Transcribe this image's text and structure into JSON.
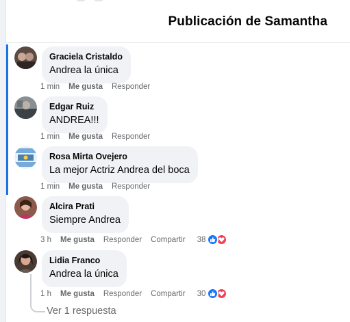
{
  "header": {
    "title": "Publicación de Samantha"
  },
  "colors": {
    "accent": "#1b74e4",
    "like": "#1877f2",
    "love": "#f33e58",
    "bubble": "#f0f2f5",
    "secondary_text": "#65676b"
  },
  "comments": [
    {
      "author": "Graciela Cristaldo",
      "text": "Andrea la única",
      "time": "1 min",
      "like_label": "Me gusta",
      "reply_label": "Responder"
    },
    {
      "author": "Edgar Ruiz",
      "text": "ANDREA!!!",
      "time": "1 min",
      "like_label": "Me gusta",
      "reply_label": "Responder"
    },
    {
      "author": "Rosa Mirta Ovejero",
      "text": "La mejor Actriz Andrea del boca",
      "time": "1 min",
      "like_label": "Me gusta",
      "reply_label": "Responder"
    },
    {
      "author": "Alcira Prati",
      "text": "Siempre Andrea",
      "time": "3 h",
      "like_label": "Me gusta",
      "reply_label": "Responder",
      "share_label": "Compartir",
      "reaction_count": "38",
      "reactions": [
        "like-icon",
        "love-icon"
      ]
    },
    {
      "author": "Lidia Franco",
      "text": "Andrea la única",
      "time": "1 h",
      "like_label": "Me gusta",
      "reply_label": "Responder",
      "share_label": "Compartir",
      "reaction_count": "30",
      "reactions": [
        "like-icon",
        "love-icon"
      ],
      "replies_label": "Ver 1 respuesta"
    }
  ]
}
